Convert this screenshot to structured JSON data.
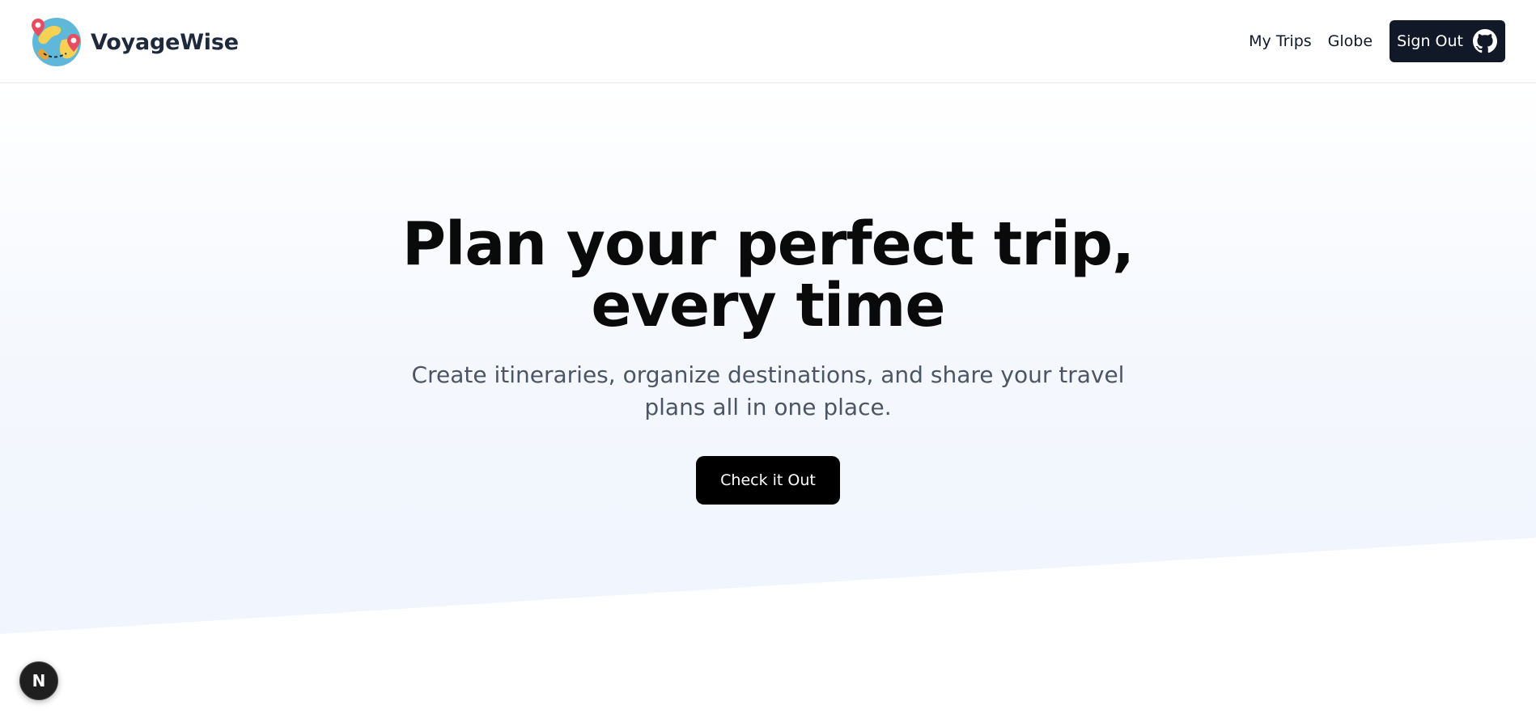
{
  "navbar": {
    "brand_name": "VoyageWise",
    "logo_icon": "globe-with-map-pins-icon",
    "links": [
      "My Trips",
      "Globe"
    ],
    "signout_label": "Sign Out",
    "signout_icon": "github-icon"
  },
  "hero": {
    "headline_line1": "Plan your perfect trip,",
    "headline_line2": "every time",
    "subheading": "Create itineraries, organize destinations, and share your travel plans all in one place.",
    "cta_label": "Check it Out"
  },
  "dev_badge": {
    "letter": "N",
    "icon": "nextjs-icon"
  },
  "colors": {
    "primary_dark": "#111827",
    "cta_black": "#000000",
    "hero_tint": "#eef4fe",
    "subtext_gray": "#4b5563"
  }
}
